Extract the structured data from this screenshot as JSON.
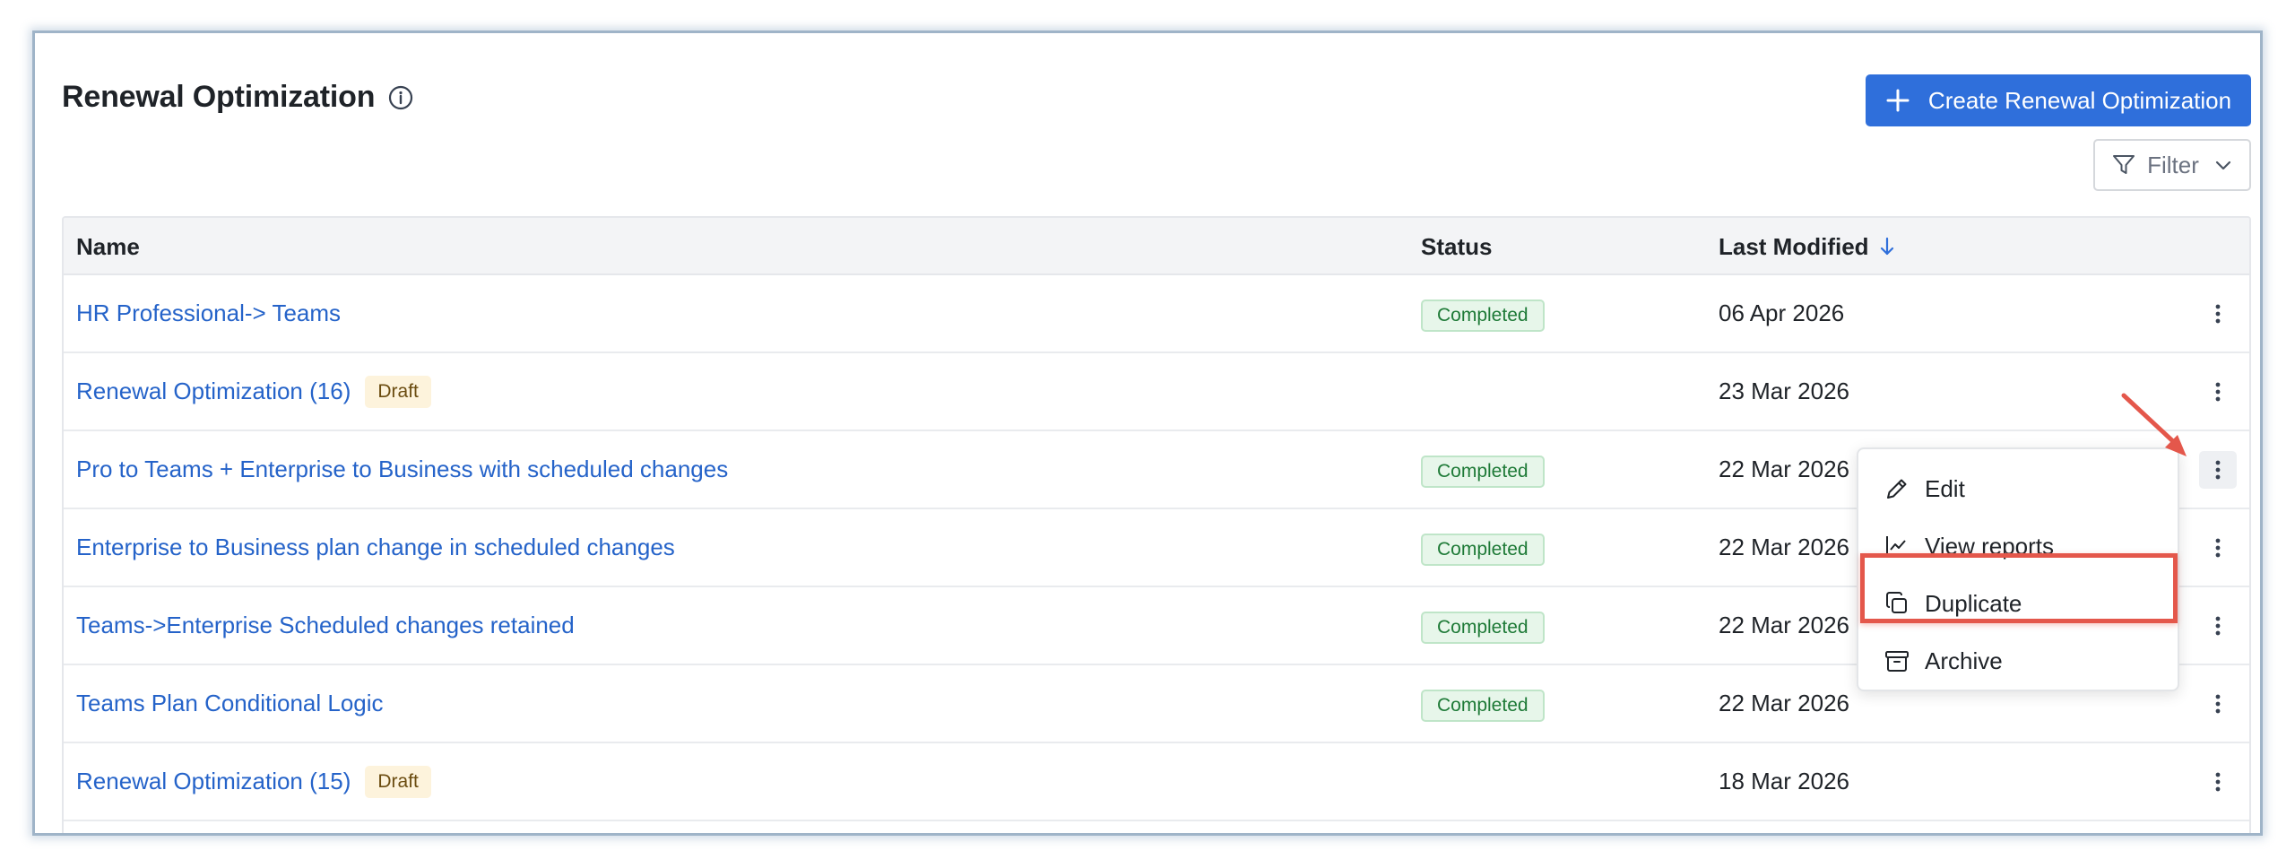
{
  "page": {
    "title": "Renewal Optimization",
    "create_button": "Create Renewal Optimization",
    "filter_button": "Filter"
  },
  "table": {
    "columns": {
      "name": "Name",
      "status": "Status",
      "modified": "Last Modified"
    },
    "rows": [
      {
        "name": "HR Professional-> Teams",
        "badge": "",
        "status": "Completed",
        "modified": "06 Apr 2026"
      },
      {
        "name": "Renewal Optimization (16)",
        "badge": "Draft",
        "status": "",
        "modified": "23 Mar 2026"
      },
      {
        "name": "Pro to Teams + Enterprise to Business with scheduled changes",
        "badge": "",
        "status": "Completed",
        "modified": "22 Mar 2026"
      },
      {
        "name": "Enterprise to Business plan change in scheduled changes",
        "badge": "",
        "status": "Completed",
        "modified": "22 Mar 2026"
      },
      {
        "name": "Teams->Enterprise Scheduled changes retained",
        "badge": "",
        "status": "Completed",
        "modified": "22 Mar 2026"
      },
      {
        "name": "Teams Plan Conditional Logic",
        "badge": "",
        "status": "Completed",
        "modified": "22 Mar 2026"
      },
      {
        "name": "Renewal Optimization (15)",
        "badge": "Draft",
        "status": "",
        "modified": "18 Mar 2026"
      }
    ]
  },
  "menu": {
    "edit": "Edit",
    "view_reports": "View reports",
    "duplicate": "Duplicate",
    "archive": "Archive"
  },
  "colors": {
    "accent": "#2f6fdb",
    "link": "#2563c9",
    "completed_bg": "#e7f6ea",
    "draft_bg": "#fdf3dc",
    "annotation": "#e4574b"
  }
}
